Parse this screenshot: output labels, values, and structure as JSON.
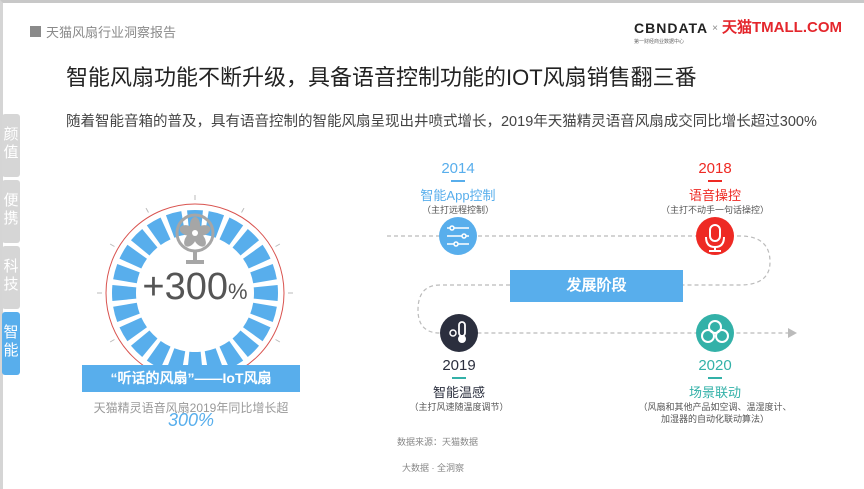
{
  "header": {
    "report_title": "天猫风扇行业洞察报告",
    "logo_cbn": "CBNDATA",
    "logo_cbn_sub": "第一财经商业数据中心",
    "logo_x": "×",
    "logo_tmall": "天猫TMALL.COM"
  },
  "title": "智能风扇功能不断升级，具备语音控制功能的IOT风扇销售翻三番",
  "description": "随着智能音箱的普及，具有语音控制的智能风扇呈现出井喷式增长，2019年天猫精灵语音风扇成交同比增长超过300%",
  "side_tabs": [
    {
      "label": "颜值"
    },
    {
      "label": "便携"
    },
    {
      "label": "科技"
    },
    {
      "label": "智能"
    }
  ],
  "gauge": {
    "value_text": "+300",
    "unit": "%",
    "segments": 24,
    "banner": "“听话的风扇”——IoT风扇",
    "caption": "天猫精灵语音风扇2019年同比增长超",
    "caption_value": "300%"
  },
  "timeline": {
    "stage_label": "发展阶段",
    "nodes": [
      {
        "year": "2014",
        "label": "智能App控制",
        "note": "（主打远程控制）",
        "color": "#58aeec",
        "icon": "sliders-icon"
      },
      {
        "year": "2018",
        "label": "语音操控",
        "note": "（主打不动手一句话操控）",
        "color": "#ee2a24",
        "icon": "microphone-icon"
      },
      {
        "year": "2019",
        "label": "智能温感",
        "note": "（主打风速随温度调节）",
        "color": "#2b2f3e",
        "icon": "thermometer-icon"
      },
      {
        "year": "2020",
        "label": "场景联动",
        "note": "（风扇和其他产品如空调、温湿度计、加湿器的自动化联动算法）",
        "color": "#33b1a8",
        "icon": "cloud-sync-icon"
      }
    ]
  },
  "source": "数据来源：天猫数据",
  "footer": "大数据 · 全洞察"
}
